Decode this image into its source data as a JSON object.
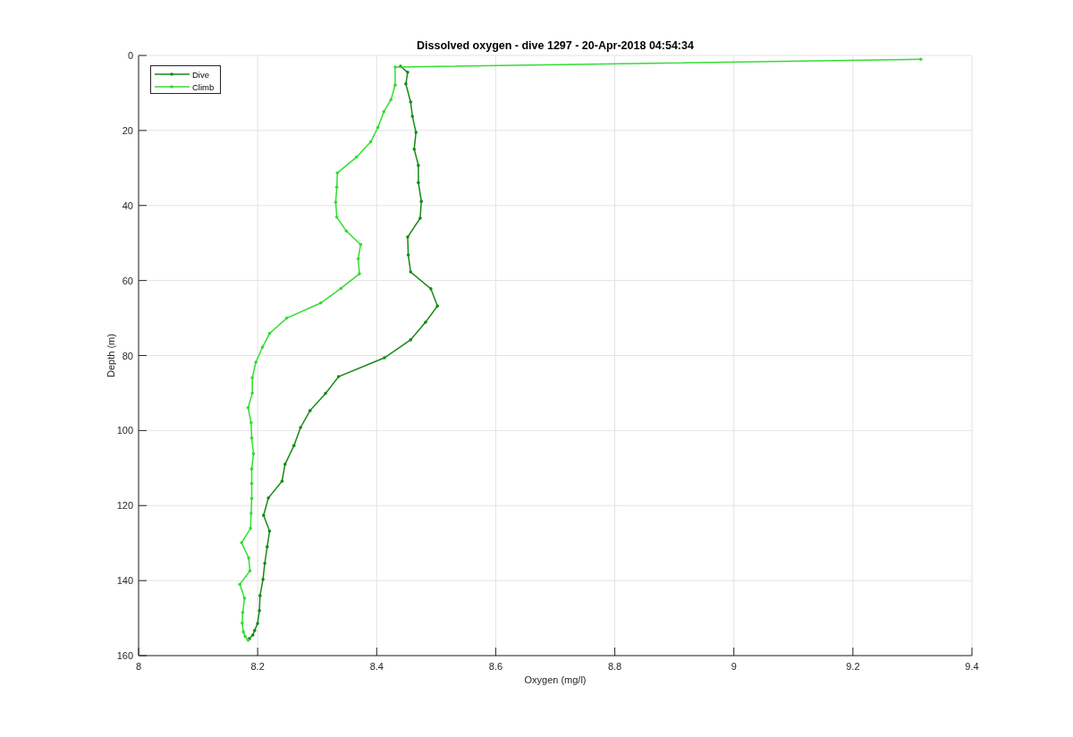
{
  "figure": {
    "chart_data": {
      "type": "line",
      "title": "Dissolved oxygen - dive 1297 - 20-Apr-2018 04:54:34",
      "xlabel": "Oxygen (mg/l)",
      "ylabel": "Depth (m)",
      "xlim": [
        8,
        9.4
      ],
      "ylim": [
        160,
        0
      ],
      "grid": true,
      "legend": true,
      "xticks": [
        8,
        8.2,
        8.4,
        8.6,
        8.8,
        9,
        9.2,
        9.4
      ],
      "yticks": [
        0,
        20,
        40,
        60,
        80,
        100,
        120,
        140,
        160
      ],
      "series": [
        {
          "name": "Dive",
          "color": "#178a17",
          "x": [
            8.44,
            8.452,
            8.449,
            8.457,
            8.46,
            8.466,
            8.463,
            8.47,
            8.47,
            8.475,
            8.473,
            8.452,
            8.453,
            8.457,
            8.491,
            8.502,
            8.482,
            8.457,
            8.413,
            8.336,
            8.314,
            8.288,
            8.272,
            8.261,
            8.246,
            8.241,
            8.218,
            8.21,
            8.22,
            8.216,
            8.212,
            8.209,
            8.204,
            8.203,
            8.2,
            8.195,
            8.192,
            8.186
          ],
          "values": [
            2.9,
            4.5,
            7.6,
            12.4,
            16.2,
            20.5,
            25,
            29.3,
            33.9,
            38.9,
            43.4,
            48.4,
            53.2,
            57.7,
            62.2,
            66.8,
            71.1,
            75.8,
            80.6,
            85.6,
            90.1,
            94.7,
            99.2,
            104,
            109,
            113.5,
            118,
            122.6,
            126.8,
            131,
            135.4,
            139.7,
            144,
            148,
            151.4,
            153.3,
            154.5,
            155.5
          ]
        },
        {
          "name": "Climb",
          "color": "#33dd33",
          "x": [
            9.314,
            8.431,
            8.431,
            8.424,
            8.412,
            8.402,
            8.39,
            8.366,
            8.334,
            8.333,
            8.331,
            8.333,
            8.349,
            8.373,
            8.369,
            8.371,
            8.34,
            8.306,
            8.249,
            8.22,
            8.208,
            8.197,
            8.191,
            8.191,
            8.184,
            8.189,
            8.19,
            8.193,
            8.19,
            8.19,
            8.19,
            8.189,
            8.188,
            8.173,
            8.185,
            8.187,
            8.17,
            8.178,
            8.175,
            8.174,
            8.176,
            8.179,
            8.184
          ],
          "values": [
            1,
            3.1,
            7.9,
            11.8,
            15,
            19.2,
            23,
            27.1,
            31.3,
            35.1,
            39.1,
            43.1,
            46.8,
            50.4,
            54.2,
            58.2,
            62.1,
            66,
            70,
            74.1,
            77.8,
            81.8,
            85.9,
            90,
            93.9,
            97.9,
            102,
            106.2,
            110.2,
            114.1,
            118.1,
            122.1,
            126.1,
            129.9,
            134,
            137.4,
            141,
            144.7,
            148.5,
            151.3,
            153.7,
            154.9,
            155.9
          ]
        }
      ]
    }
  }
}
